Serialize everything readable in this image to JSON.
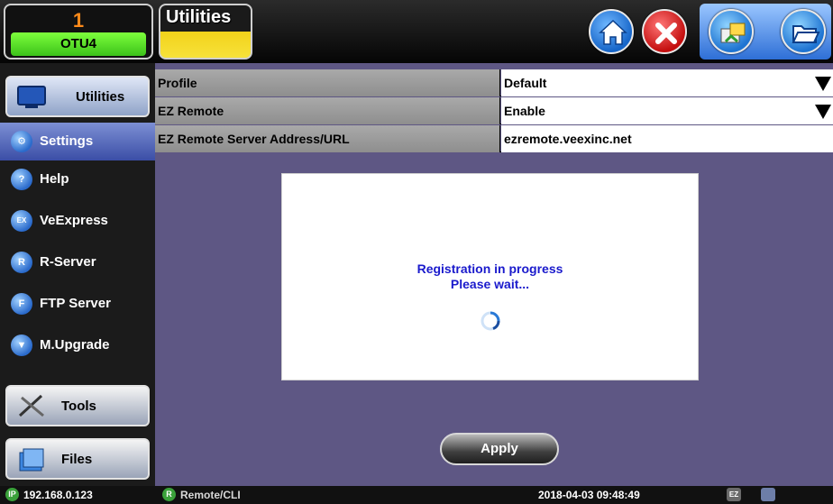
{
  "header": {
    "port_number": "1",
    "port_label": "OTU4",
    "title": "Utilities"
  },
  "toolbar": {
    "icons": [
      "home-icon",
      "close-icon",
      "share-icon",
      "folder-open-icon"
    ]
  },
  "sidebar": {
    "utilities_label": "Utilities",
    "items": [
      {
        "label": "Settings",
        "icon": "settings-icon",
        "selected": true
      },
      {
        "label": "Help",
        "icon": "help-icon",
        "glyph": "?"
      },
      {
        "label": "VeExpress",
        "icon": "veexpress-icon",
        "glyph": "EX"
      },
      {
        "label": "R-Server",
        "icon": "r-server-icon",
        "glyph": "R"
      },
      {
        "label": "FTP Server",
        "icon": "ftp-server-icon",
        "glyph": "F"
      },
      {
        "label": "M.Upgrade",
        "icon": "upgrade-icon",
        "glyph": "▼"
      }
    ],
    "tools_label": "Tools",
    "files_label": "Files"
  },
  "settings": {
    "profile_label": "Profile",
    "profile_value": "Default",
    "ezremote_label": "EZ Remote",
    "ezremote_value": "Enable",
    "server_label": "EZ Remote Server Address/URL",
    "server_value": "ezremote.veexinc.net"
  },
  "dialog": {
    "line1": "Registration in progress",
    "line2": "Please wait..."
  },
  "apply_label": "Apply",
  "status": {
    "ip_badge": "IP",
    "ip": "192.168.0.123",
    "remote_badge": "R",
    "remote": "Remote/CLI",
    "datetime": "2018-04-03 09:48:49",
    "ez_badge": "EZ"
  },
  "colors": {
    "accent_green": "#3cc21a",
    "title_yellow": "#f2d21a",
    "panel_bg": "#5e5784",
    "dialog_text": "#1a1acc"
  }
}
